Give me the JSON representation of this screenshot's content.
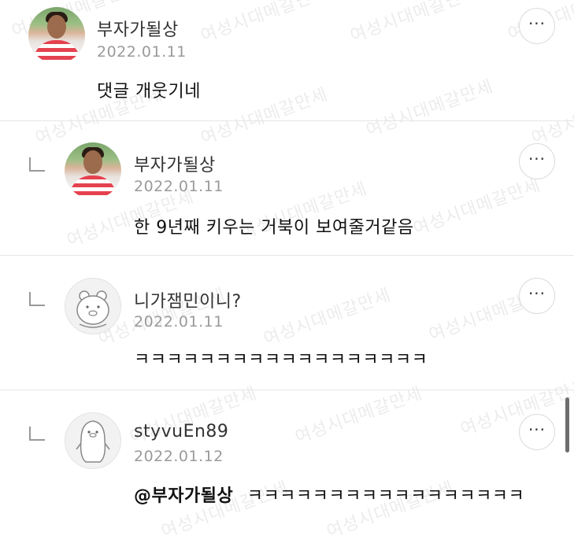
{
  "watermark": "여성시대메갈만세",
  "comments": [
    {
      "username": "부자가될상",
      "date": "2022.01.11",
      "text": "댓글 개웃기네",
      "more_label": "···",
      "avatar": "profile-photo"
    },
    {
      "username": "부자가될상",
      "date": "2022.01.11",
      "text": "한 9년째 키우는 거북이 보여줄거같음",
      "more_label": "···",
      "avatar": "profile-photo",
      "is_reply": true
    },
    {
      "username": "니가잼민이니?",
      "date": "2022.01.11",
      "text": "ㅋㅋㅋㅋㅋㅋㅋㅋㅋㅋㅋㅋㅋㅋㅋㅋㅋㅋ",
      "more_label": "···",
      "avatar": "default-bear",
      "is_reply": true
    },
    {
      "username": "styvuEn89",
      "date": "2022.01.12",
      "mention": "@부자가될상",
      "text": "ㅋㅋㅋㅋㅋㅋㅋㅋㅋㅋㅋㅋㅋㅋㅋㅋㅋ",
      "more_label": "···",
      "avatar": "default-penguin",
      "is_reply": true
    }
  ],
  "colors": {
    "username": "#333333",
    "date": "#9a9a9a",
    "divider": "#e6e6e6",
    "text": "#111111"
  }
}
